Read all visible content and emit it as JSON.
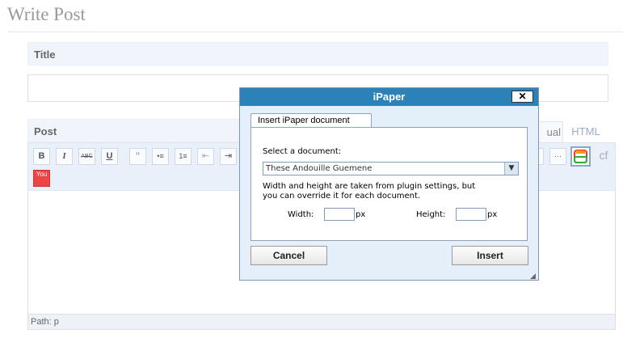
{
  "page": {
    "title": "Write Post"
  },
  "title_box": {
    "heading": "Title",
    "value": ""
  },
  "post_box": {
    "heading": "Post",
    "tabs": [
      {
        "label": "ual"
      },
      {
        "label": "HTML"
      }
    ],
    "toolbar": {
      "buttons": [
        "B",
        "I",
        "ABC",
        "U",
        "“",
        "•≡",
        "1≡",
        "⇤",
        "⇥"
      ],
      "right_buttons": [
        "▯",
        "⋯",
        "iPaper",
        "cf"
      ],
      "youtube": "You"
    },
    "path": "Path: p"
  },
  "dialog": {
    "title": "iPaper",
    "close_label": "✕",
    "tab_label": "Insert iPaper document",
    "select_label": "Select a document:",
    "selected_document": "These Andouille Guemene",
    "note_line1": "Width and height are taken from plugin settings, but",
    "note_line2": "you can override it for each document.",
    "width_label": "Width:",
    "height_label": "Height:",
    "unit": "px",
    "width_value": "",
    "height_value": "",
    "cancel_label": "Cancel",
    "insert_label": "Insert"
  }
}
